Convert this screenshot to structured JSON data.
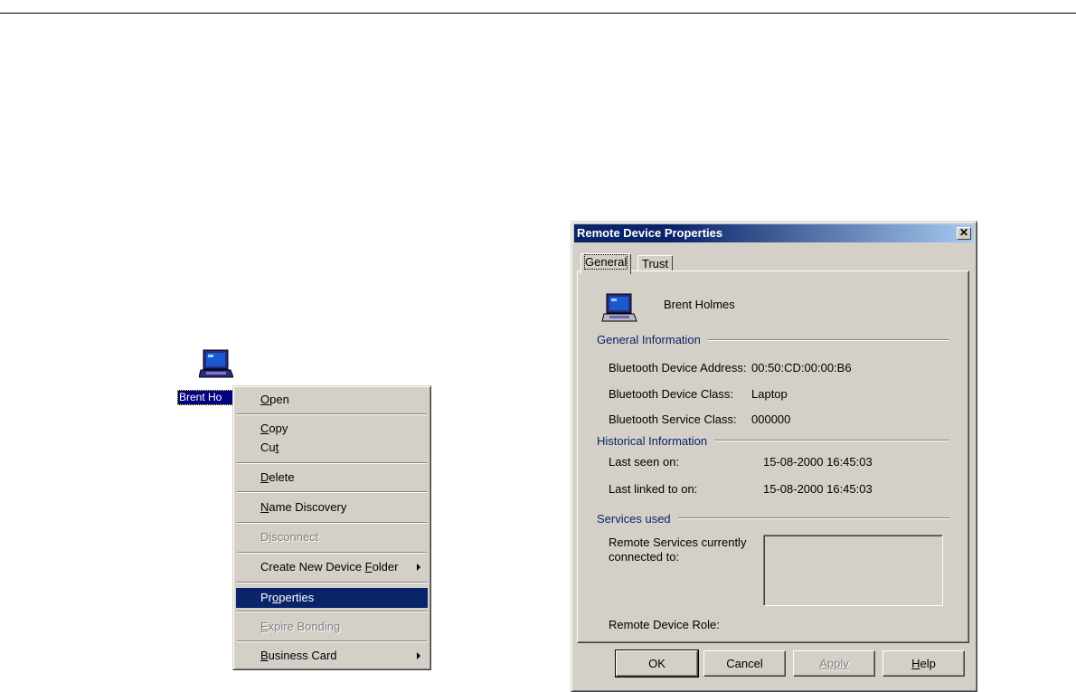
{
  "desktop": {
    "icon": "laptop-icon",
    "label": "Brent Ho"
  },
  "context_menu": {
    "items": [
      {
        "label": "Open",
        "key": "O",
        "rest": "pen"
      },
      {
        "label": "Copy",
        "key": "C",
        "rest": "opy"
      },
      {
        "label": "Cut",
        "pre": "Cu",
        "key": "t"
      },
      {
        "label": "Delete",
        "key": "D",
        "rest": "elete"
      },
      {
        "label": "Name Discovery",
        "key": "N",
        "rest": "ame Discovery"
      },
      {
        "label": "Disconnect",
        "pre": "D",
        "key": "i",
        "rest": "sconnect",
        "disabled": true
      },
      {
        "label": "Create New Device Folder",
        "pre": "Create New Device ",
        "key": "F",
        "rest": "older",
        "submenu": true
      },
      {
        "label": "Properties",
        "pre": "Pr",
        "key": "o",
        "rest": "perties",
        "selected": true
      },
      {
        "label": "Expire Bonding",
        "key": "E",
        "rest": "xpire Bonding",
        "disabled": true
      },
      {
        "label": "Business Card",
        "key": "B",
        "rest": "usiness Card",
        "submenu": true
      }
    ]
  },
  "dialog": {
    "title": "Remote Device Properties",
    "close_glyph": "✕",
    "tabs": [
      {
        "label": "General",
        "active": true
      },
      {
        "label": "Trust",
        "active": false
      }
    ],
    "device_icon": "laptop-icon",
    "device_name": "Brent Holmes",
    "general_info": {
      "title": "General Information",
      "address_label": "Bluetooth Device Address:",
      "address_value": "00:50:CD:00:00:B6",
      "class_label": "Bluetooth Device Class:",
      "class_value": "Laptop",
      "service_label": "Bluetooth Service Class:",
      "service_value": "000000"
    },
    "historical_info": {
      "title": "Historical Information",
      "last_seen_label": "Last seen on:",
      "last_seen_value": "15-08-2000 16:45:03",
      "last_linked_label": "Last linked to on:",
      "last_linked_value": "15-08-2000 16:45:03"
    },
    "services": {
      "title": "Services used",
      "connected_label_1": "Remote Services currently",
      "connected_label_2": "connected to:",
      "role_label": "Remote Device Role:"
    },
    "buttons": {
      "ok": "OK",
      "cancel": "Cancel",
      "apply": "Apply",
      "help_key": "H",
      "help_rest": "elp"
    }
  },
  "colors": {
    "face": "#d4d0c8",
    "selection": "#0a246a",
    "group_title": "#0a246a"
  }
}
